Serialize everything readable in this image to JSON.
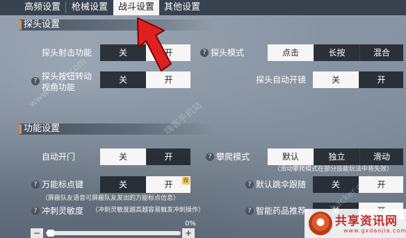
{
  "tabs": [
    {
      "label": "高频设置"
    },
    {
      "label": "枪械设置"
    },
    {
      "label": "战斗设置"
    },
    {
      "label": "其他设置"
    }
  ],
  "probe_section": {
    "title": "探头设置",
    "shoot_label": "探头射击功能",
    "shoot_options": [
      "关",
      "开"
    ],
    "mode_label": "探头模式",
    "mode_options": [
      "点击",
      "长按",
      "混合"
    ],
    "rotate_label_line1": "探头按钮转动",
    "rotate_label_line2": "视角功能",
    "rotate_options": [
      "关",
      "开"
    ],
    "auto_scope_label": "探头自动开镜",
    "auto_scope_options": [
      "关",
      "开"
    ]
  },
  "function_section": {
    "title": "功能设置",
    "auto_door_label": "自动开门",
    "auto_door_options": [
      "关",
      "开"
    ],
    "climb_label": "攀爬模式",
    "climb_options": [
      "默认",
      "独立",
      "滑动"
    ],
    "climb_note": "（滑动攀爬模式在部分技能玩法中将失效）",
    "marker_label": "万能标点键",
    "marker_options": [
      "关",
      "开"
    ],
    "marker_badge": "荐",
    "marker_note": "（屏蔽队友语音可屏蔽队友发出的万能标点信息）",
    "parachute_label": "默认跳伞跟随",
    "parachute_options": [
      "关",
      "开"
    ],
    "sprint_label": "冲刺灵敏度",
    "sprint_note": "（冲刺灵敏度越高越容易触发冲刺操作）",
    "sprint_value": "0%",
    "slider_minus": "−",
    "slider_plus": "+",
    "medicine_label": "智能药品推荐",
    "medicine_options": [
      "关",
      "开"
    ]
  },
  "help_symbol": "?",
  "watermarks": [
    "www.youxi.com",
    "嗨客手机站",
    "Shouji.hacker.com"
  ],
  "logo": {
    "title": "共享资讯网",
    "subtitle": "www.gxdaojia.com"
  },
  "colors": {
    "accent": "#f08a3a",
    "arrow": "#e02020",
    "on_option": "#f6f6f6",
    "off_option": "#22282f"
  }
}
